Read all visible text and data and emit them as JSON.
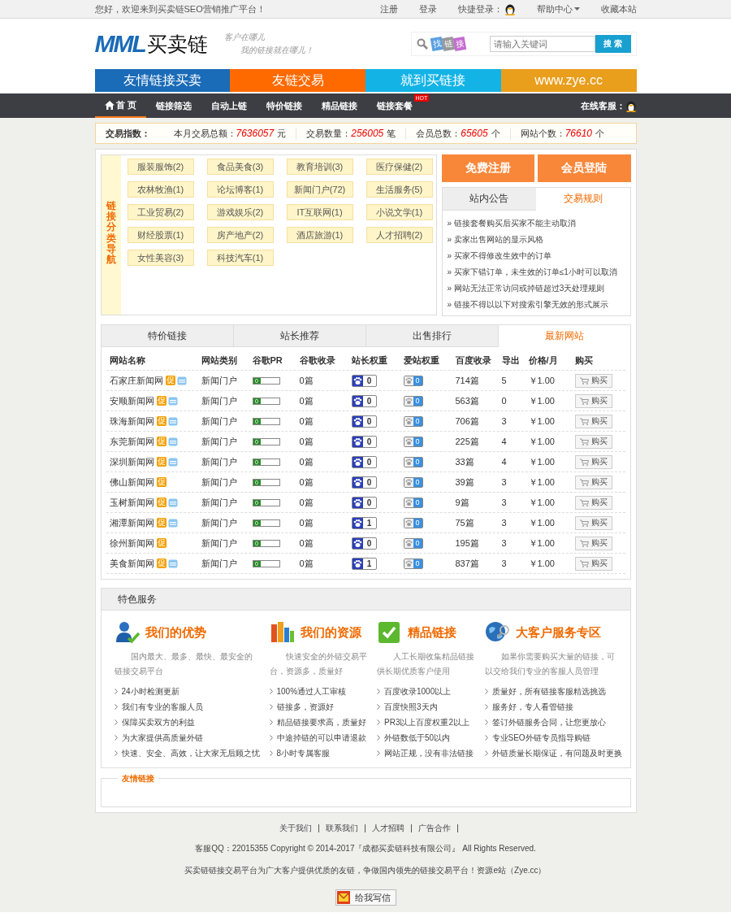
{
  "top_bar": {
    "welcome": "您好，欢迎来到买卖链SEO营销推广平台！",
    "links": [
      {
        "label": "注册",
        "kind": "plain"
      },
      {
        "label": "登录",
        "kind": "plain"
      },
      {
        "label": "快捷登录：",
        "kind": "qq"
      },
      {
        "label": "帮助中心",
        "kind": "dropdown"
      },
      {
        "label": "收藏本站",
        "kind": "plain"
      }
    ]
  },
  "header": {
    "logo_mark": "MML",
    "logo_text": "买卖链",
    "slogan": [
      "客户在哪儿",
      "我的链接就在哪儿！"
    ],
    "find_tags": [
      "找",
      "链",
      "接"
    ],
    "search": {
      "placeholder": "请输入关键词",
      "button": "搜 索"
    }
  },
  "banner": [
    {
      "text": "友情链接买卖",
      "color": "#1a6bb8"
    },
    {
      "text": "友链交易",
      "color": "#ff6a00"
    },
    {
      "text": "就到买链接",
      "color": "#13b3e6"
    },
    {
      "text": "www.zye.cc",
      "color": "#e99e1c"
    }
  ],
  "nav": {
    "items": [
      {
        "label": "首 页",
        "selected": true
      },
      {
        "label": "链接筛选",
        "selected": false
      },
      {
        "label": "自动上链",
        "selected": false
      },
      {
        "label": "特价链接",
        "selected": false
      },
      {
        "label": "精品链接",
        "selected": false
      },
      {
        "label": "链接套餐",
        "selected": false,
        "badge": "HOT"
      }
    ],
    "service_label": "在线客服："
  },
  "stats": {
    "title": "交易指数：",
    "items": [
      {
        "label": "本月交易总额：",
        "value": "7636057",
        "unit": "元"
      },
      {
        "label": "交易数量：",
        "value": "256005",
        "unit": "笔"
      },
      {
        "label": "会员总数：",
        "value": "65605",
        "unit": "个"
      },
      {
        "label": "网站个数：",
        "value": "76610",
        "unit": "个"
      }
    ]
  },
  "categories": {
    "title": "链接分类导航",
    "items": [
      "服装服饰(2)",
      "食品美食(3)",
      "教育培训(3)",
      "医疗保健(2)",
      "农林牧渔(1)",
      "论坛博客(1)",
      "新闻门户(72)",
      "生活服务(5)",
      "工业贸易(2)",
      "游戏娱乐(2)",
      "IT互联网(1)",
      "小说文学(1)",
      "财经股票(1)",
      "房产地产(2)",
      "酒店旅游(1)",
      "人才招聘(2)",
      "女性美容(3)",
      "科技汽车(1)"
    ]
  },
  "auth_buttons": [
    "免费注册",
    "会员登陆"
  ],
  "notice": {
    "tabs": [
      {
        "label": "站内公告",
        "selected": false
      },
      {
        "label": "交易规则",
        "selected": true
      }
    ],
    "items": [
      "» 链接套餐购买后买家不能主动取消",
      "» 卖家出售网站的显示风格",
      "» 买家不得修改生效中的订单",
      "» 买家下错订单，未生效的订单≤1小时可以取消",
      "» 网站无法正常访问或掉链超过3天处理规则",
      "» 链接不得以以下对搜索引擎无效的形式展示"
    ]
  },
  "listing": {
    "tabs": [
      {
        "label": "特价链接",
        "selected": false
      },
      {
        "label": "站长推荐",
        "selected": false
      },
      {
        "label": "出售排行",
        "selected": false
      },
      {
        "label": "最新网站",
        "selected": true
      }
    ],
    "columns": [
      "网站名称",
      "网站类别",
      "谷歌PR",
      "谷歌收录",
      "站长权重",
      "爱站权重",
      "百度收录",
      "导出",
      "价格/月",
      "购买"
    ],
    "rows": [
      {
        "name": "石家庄新闻网",
        "promo": "促",
        "verified": true,
        "category": "新闻门户",
        "pr": "0",
        "google_index": "0篇",
        "chinaz_weight": "0",
        "aizhan_weight": "0",
        "baidu_index": "714篇",
        "outbound": "5",
        "price": "￥1.00",
        "buy": "购买"
      },
      {
        "name": "安顺新闻网",
        "promo": "促",
        "verified": true,
        "category": "新闻门户",
        "pr": "0",
        "google_index": "0篇",
        "chinaz_weight": "0",
        "aizhan_weight": "0",
        "baidu_index": "563篇",
        "outbound": "0",
        "price": "￥1.00",
        "buy": "购买"
      },
      {
        "name": "珠海新闻网",
        "promo": "促",
        "verified": true,
        "category": "新闻门户",
        "pr": "0",
        "google_index": "0篇",
        "chinaz_weight": "0",
        "aizhan_weight": "0",
        "baidu_index": "706篇",
        "outbound": "3",
        "price": "￥1.00",
        "buy": "购买"
      },
      {
        "name": "东莞新闻网",
        "promo": "促",
        "verified": true,
        "category": "新闻门户",
        "pr": "0",
        "google_index": "0篇",
        "chinaz_weight": "0",
        "aizhan_weight": "0",
        "baidu_index": "225篇",
        "outbound": "4",
        "price": "￥1.00",
        "buy": "购买"
      },
      {
        "name": "深圳新闻网",
        "promo": "促",
        "verified": true,
        "category": "新闻门户",
        "pr": "0",
        "google_index": "0篇",
        "chinaz_weight": "0",
        "aizhan_weight": "0",
        "baidu_index": "33篇",
        "outbound": "4",
        "price": "￥1.00",
        "buy": "购买"
      },
      {
        "name": "佛山新闻网",
        "promo": "促",
        "verified": false,
        "category": "新闻门户",
        "pr": "0",
        "google_index": "0篇",
        "chinaz_weight": "0",
        "aizhan_weight": "0",
        "baidu_index": "39篇",
        "outbound": "3",
        "price": "￥1.00",
        "buy": "购买"
      },
      {
        "name": "玉树新闻网",
        "promo": "促",
        "verified": true,
        "category": "新闻门户",
        "pr": "0",
        "google_index": "0篇",
        "chinaz_weight": "0",
        "aizhan_weight": "0",
        "baidu_index": "9篇",
        "outbound": "3",
        "price": "￥1.00",
        "buy": "购买"
      },
      {
        "name": "湘潭新闻网",
        "promo": "促",
        "verified": true,
        "category": "新闻门户",
        "pr": "0",
        "google_index": "0篇",
        "chinaz_weight": "1",
        "aizhan_weight": "0",
        "baidu_index": "75篇",
        "outbound": "3",
        "price": "￥1.00",
        "buy": "购买"
      },
      {
        "name": "徐州新闻网",
        "promo": "促",
        "verified": false,
        "category": "新闻门户",
        "pr": "0",
        "google_index": "0篇",
        "chinaz_weight": "0",
        "aizhan_weight": "0",
        "baidu_index": "195篇",
        "outbound": "3",
        "price": "￥1.00",
        "buy": "购买"
      },
      {
        "name": "美食新闻网",
        "promo": "促",
        "verified": true,
        "category": "新闻门户",
        "pr": "0",
        "google_index": "0篇",
        "chinaz_weight": "1",
        "aizhan_weight": "0",
        "baidu_index": "837篇",
        "outbound": "3",
        "price": "￥1.00",
        "buy": "购买"
      }
    ]
  },
  "services": {
    "title": "特色服务",
    "columns": [
      {
        "kind": "user",
        "title": "我们的优势",
        "desc": "国内最大、最多、最快、最安全的链接交易平台",
        "points": [
          "24小时检测更新",
          "我们有专业的客服人员",
          "保障买卖双方的利益",
          "为大家提供高质量外链",
          "快速、安全、高效，让大家无后顾之忧"
        ]
      },
      {
        "kind": "chart",
        "title": "我们的资源",
        "desc": "快速安全的外链交易平台，资源多，质量好",
        "points": [
          "100%通过人工审核",
          "链接多，资源好",
          "精品链接要求高，质量好",
          "中途掉链的可以申请退款",
          "8小时专属客服"
        ]
      },
      {
        "kind": "check",
        "title": "精品链接",
        "desc": "人工长期收集精品链接供长期优质客户使用",
        "points": [
          "百度收录1000以上",
          "百度快照3天内",
          "PR3以上百度权重2以上",
          "外链数低于50以内",
          "网站正规，没有非法链接"
        ]
      },
      {
        "kind": "globe",
        "title": "大客户服务专区",
        "desc": "如果你需要购买大量的链接，可以交给我们专业的客服人员管理",
        "points": [
          "质量好，所有链接客服精选挑选",
          "服务好，专人看管链接",
          "签订外链服务合同，让您更放心",
          "专业SEO外链专员指导购链",
          "外链质量长期保证，有问题及时更换"
        ]
      }
    ]
  },
  "friend_links": {
    "title": "友情链接"
  },
  "footer": {
    "links": [
      "关于我们",
      "联系我们",
      "人才招聘",
      "广告合作"
    ],
    "copyright": "客服QQ：22015355 Copyright © 2014-2017『成都买卖链科技有限公司』 All Rights Reserved.",
    "tagline": "买卖链链接交易平台为广大客户提供优质的友链，争做国内领先的链接交易平台！资源e站（Zye.cc）",
    "mail_button": "给我写信"
  }
}
